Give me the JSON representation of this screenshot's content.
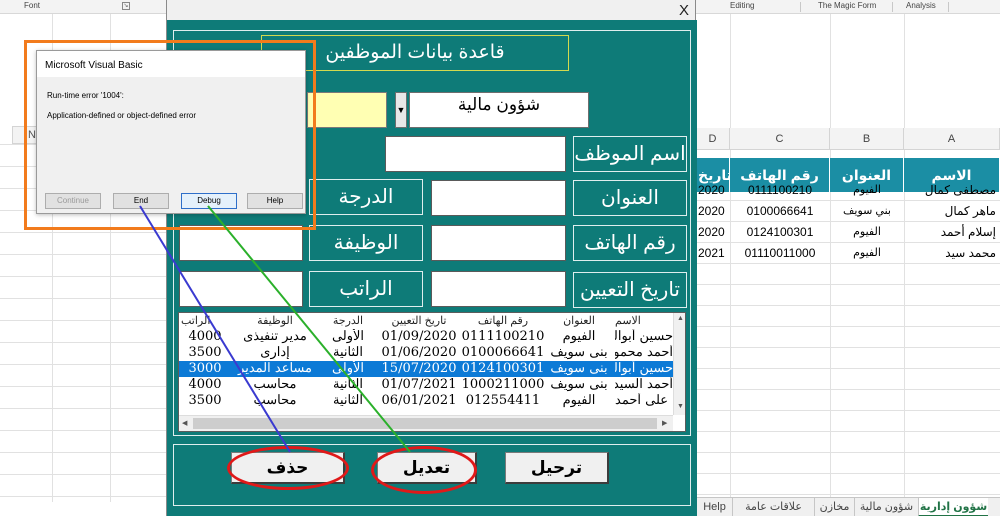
{
  "excel": {
    "ribbon": {
      "font_group": "Font",
      "editing_group": "Editing",
      "magic_form_group": "The Magic Form",
      "analysis_group": "Analysis"
    },
    "left_column_header": "N",
    "column_headers": [
      "D",
      "C",
      "B",
      "A"
    ],
    "table_headers": {
      "a": "الاسم",
      "b": "العنوان",
      "c": "رقم الهاتف",
      "d": "تاريخ"
    },
    "rows": [
      {
        "a": "مصطفى كمال",
        "b": "الفيوم",
        "c": "0111100210",
        "d": "2020"
      },
      {
        "a": "ماهر كمال",
        "b": "بني سويف",
        "c": "0100066641",
        "d": "2020"
      },
      {
        "a": "إسلام أحمد",
        "b": "الفيوم",
        "c": "0124100301",
        "d": "2020"
      },
      {
        "a": "محمد سيد",
        "b": "الفيوم",
        "c": "01110011000",
        "d": "2021"
      }
    ],
    "sheet_tabs": [
      {
        "label": "شؤون إدارية",
        "active": true
      },
      {
        "label": "شؤون مالية",
        "active": false
      },
      {
        "label": "مخازن",
        "active": false
      },
      {
        "label": "علاقات عامة",
        "active": false
      },
      {
        "label": "Help",
        "active": false
      }
    ]
  },
  "form": {
    "close_glyph": "X",
    "title": "قاعدة بيانات الموظفين",
    "department_value": "شؤون مالية",
    "dropdown_arrow": "▼",
    "labels": {
      "name": "اسم الموظف",
      "address": "العنوان",
      "phone": "رقم الهاتف",
      "hire_date": "تاريخ التعيين",
      "grade": "الدرجة",
      "job": "الوظيفة",
      "salary": "الراتب"
    },
    "list": {
      "headers": [
        "الاسم",
        "العنوان",
        "رقم الهاتف",
        "تاريخ التعيين",
        "الدرجة",
        "الوظيفة",
        "الراتب"
      ],
      "rows": [
        [
          "حسين أبوالخير",
          "الفيوم",
          "0111100210",
          "01/09/2020",
          "الأولى",
          "مدير تنفيذى",
          "4000"
        ],
        [
          "أحمد محمود",
          "بنى سويف",
          "0100066641",
          "01/06/2020",
          "الثانية",
          "إدارى",
          "3500"
        ],
        [
          "حسين أبوالخير",
          "بنى سويف",
          "0124100301",
          "15/07/2020",
          "الأولى",
          "مساعد المدير",
          "3000"
        ],
        [
          "أحمد السيد",
          "بنى سويف",
          "1000211000",
          "01/07/2021",
          "الثانية",
          "محاسب",
          "4000"
        ],
        [
          "على أحمد",
          "الفيوم",
          "012554411",
          "06/01/2021",
          "الثانية",
          "محاسب",
          "3500"
        ]
      ],
      "selected_index": 2
    },
    "buttons": {
      "delete": "حذف",
      "edit": "تعديل",
      "transfer": "ترحيل"
    }
  },
  "error_dialog": {
    "title": "Microsoft Visual Basic",
    "message_1": "Run-time error '1004':",
    "message_2": "Application-defined or object-defined error",
    "buttons": {
      "continue": "Continue",
      "end": "End",
      "debug": "Debug",
      "help": "Help"
    }
  },
  "colors": {
    "form_bg": "#0e7b78",
    "header_fill": "#1b8ea4",
    "selection": "#0c7ad6",
    "highlight_ring": "#e01919",
    "dialog_frame": "#f27b1c",
    "connector_blue": "#3a3ad0",
    "connector_green": "#2bb02b"
  }
}
